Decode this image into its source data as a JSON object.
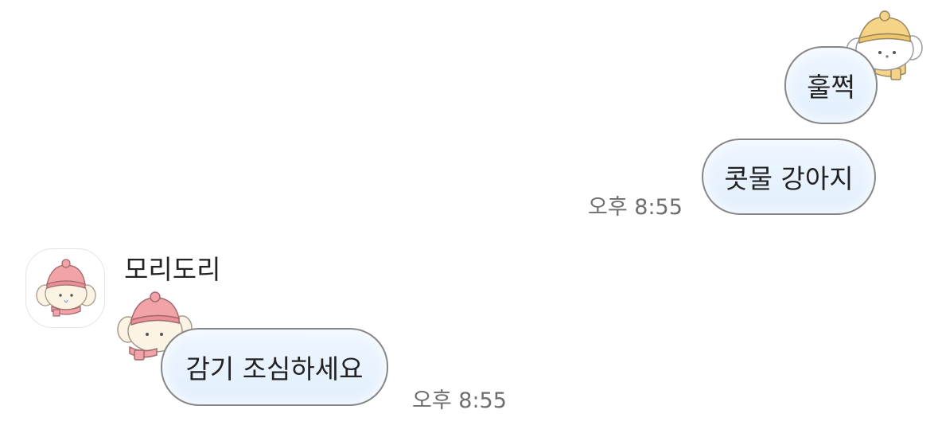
{
  "messages": {
    "outgoing": [
      {
        "text": "훌쩍"
      },
      {
        "text": "콧물 강아지",
        "time": "오후 8:55"
      }
    ],
    "incoming": [
      {
        "sender": "모리도리",
        "text": "감기 조심하세요",
        "time": "오후 8:55"
      }
    ]
  },
  "theme": {
    "bubble_fill": "#e6f1fd",
    "bubble_border": "#878787",
    "timestamp_color": "#6e6e6e",
    "hat_yellow": "#f5d487",
    "hat_pink": "#f2a3a8",
    "puppy_cream": "#fbf3e4"
  },
  "icons": {
    "outgoing_sticker": "puppy-yellow-hat-icon",
    "incoming_sticker": "puppy-pink-hat-icon",
    "avatar": "puppy-pink-hat-avatar"
  }
}
